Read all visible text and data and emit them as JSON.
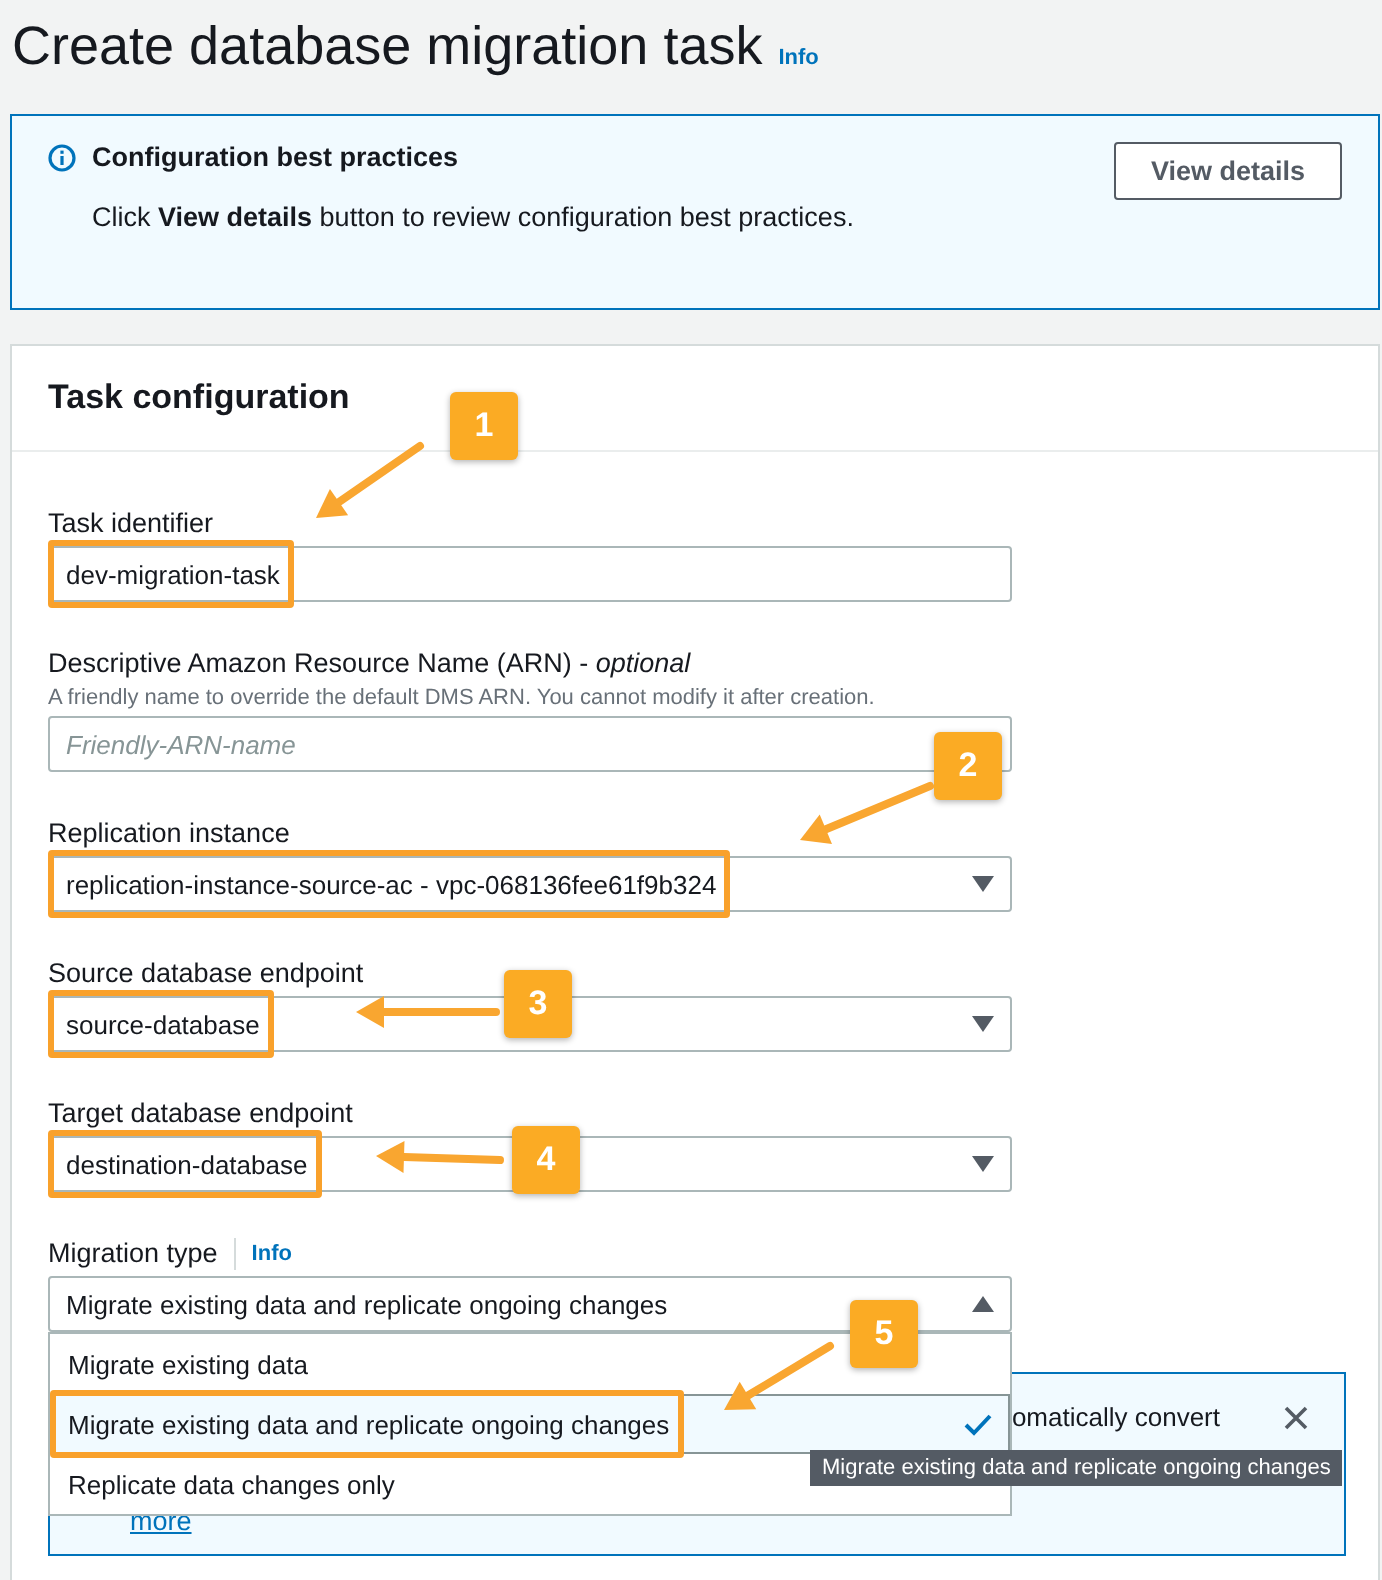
{
  "page": {
    "title": "Create database migration task",
    "info_link": "Info"
  },
  "alert": {
    "title": "Configuration best practices",
    "body": "Click **View details** button to review configuration best practices.",
    "button": "View details"
  },
  "panel": {
    "title": "Task configuration",
    "fields": [
      {
        "kind": "text",
        "label": "Task identifier",
        "value": "dev-migration-task",
        "highlighted": true
      },
      {
        "kind": "text",
        "label": "Descriptive Amazon Resource Name (ARN) - *optional*",
        "description": "A friendly name to override the default DMS ARN. You cannot modify it after creation.",
        "placeholder": "Friendly-ARN-name",
        "highlighted": false
      },
      {
        "kind": "select",
        "label": "Replication instance",
        "value": "replication-instance-source-ac - vpc-068136fee61f9b324",
        "highlighted": true,
        "expanded": false
      },
      {
        "kind": "select",
        "label": "Source database endpoint",
        "value": "source-database",
        "highlighted": true,
        "expanded": false
      },
      {
        "kind": "select",
        "label": "Target database endpoint",
        "value": "destination-database",
        "highlighted": true,
        "expanded": false
      },
      {
        "kind": "select",
        "label": "Migration type",
        "info_link": "Info",
        "value": "Migrate existing data and replicate ongoing changes",
        "highlighted": false,
        "expanded": true,
        "options": [
          {
            "label": "Migrate existing data",
            "selected": false,
            "highlighted": false
          },
          {
            "label": "Migrate existing data and replicate ongoing changes",
            "selected": true,
            "highlighted": true
          },
          {
            "label": "Replicate data changes only",
            "selected": false,
            "highlighted": false
          }
        ]
      }
    ],
    "notice": {
      "text": "omatically convert",
      "link": "more"
    }
  },
  "tooltip": "Migrate existing data and replicate ongoing changes",
  "callouts": [
    {
      "number": "1"
    },
    {
      "number": "2"
    },
    {
      "number": "3"
    },
    {
      "number": "4"
    },
    {
      "number": "5"
    }
  ]
}
